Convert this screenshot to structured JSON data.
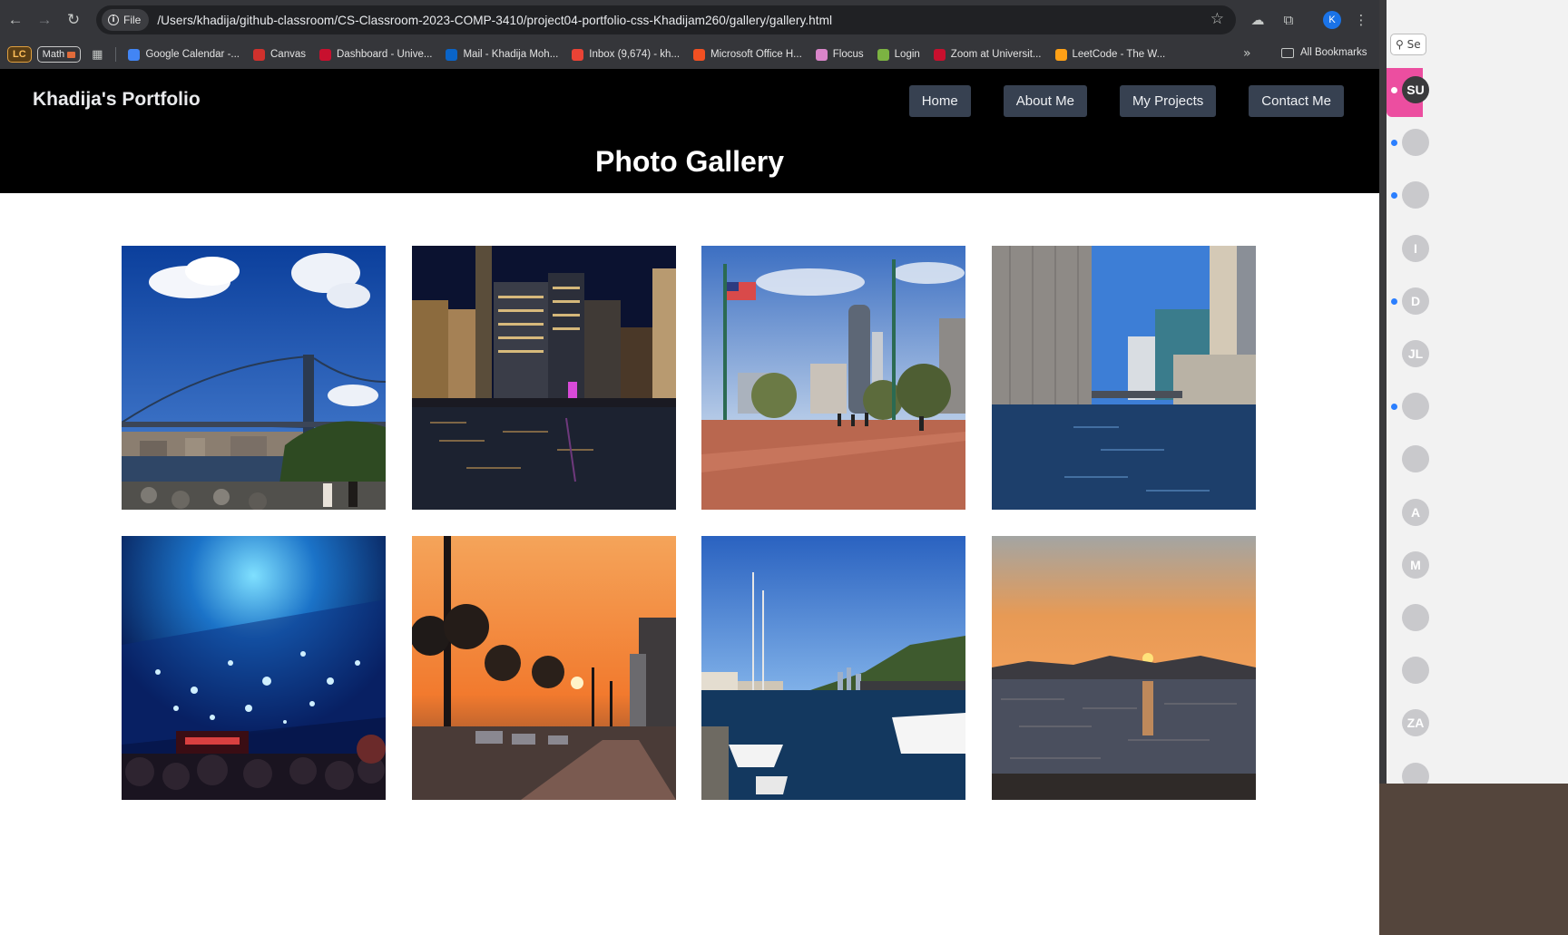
{
  "browser": {
    "site_chip_label": "File",
    "url": "/Users/khadija/github-classroom/CS-Classroom-2023-COMP-3410/project04-portfolio-css-Khadijam260/gallery/gallery.html",
    "profile_initial": "K",
    "icons": {
      "back": "back-arrow-icon",
      "forward": "forward-arrow-icon",
      "reload": "reload-icon",
      "info": "info-icon",
      "star": "bookmark-star-icon",
      "extensions": "puzzle-icon",
      "menu": "kebab-menu-icon"
    }
  },
  "bookmarks": {
    "lc_badge": "LC",
    "math_badge": "Math",
    "items": [
      {
        "label": "Google Calendar -...",
        "color": "#4285f4"
      },
      {
        "label": "Canvas",
        "color": "#d0312d"
      },
      {
        "label": "Dashboard - Unive...",
        "color": "#c8102e"
      },
      {
        "label": "Mail - Khadija Moh...",
        "color": "#0a64c8"
      },
      {
        "label": "Inbox (9,674) - kh...",
        "color": "#ea4335"
      },
      {
        "label": "Microsoft Office H...",
        "color": "#f25022"
      },
      {
        "label": "Flocus",
        "color": "#d985c9"
      },
      {
        "label": "Login",
        "color": "#7cb342"
      },
      {
        "label": "Zoom at Universit...",
        "color": "#c8102e"
      },
      {
        "label": "LeetCode - The W...",
        "color": "#ffa116"
      }
    ],
    "more_label": "»",
    "all_bookmarks_label": "All Bookmarks"
  },
  "site": {
    "brand": "Khadija's Portfolio",
    "nav": [
      "Home",
      "About Me",
      "My Projects",
      "Contact Me"
    ],
    "title": "Photo Gallery",
    "photos": [
      "brooklyn-bridge-photo",
      "city-skyline-night-photo",
      "waterfront-promenade-photo",
      "river-canal-photo",
      "aquarium-tunnel-photo",
      "sunset-street-photo",
      "marina-sailboats-photo",
      "sunset-over-water-photo"
    ]
  },
  "side_panel": {
    "search_label": "Se",
    "avatars": [
      "SU",
      "",
      "",
      "I",
      "D",
      "JL",
      "",
      "",
      "A",
      "M",
      "",
      "",
      "ZA",
      ""
    ]
  }
}
